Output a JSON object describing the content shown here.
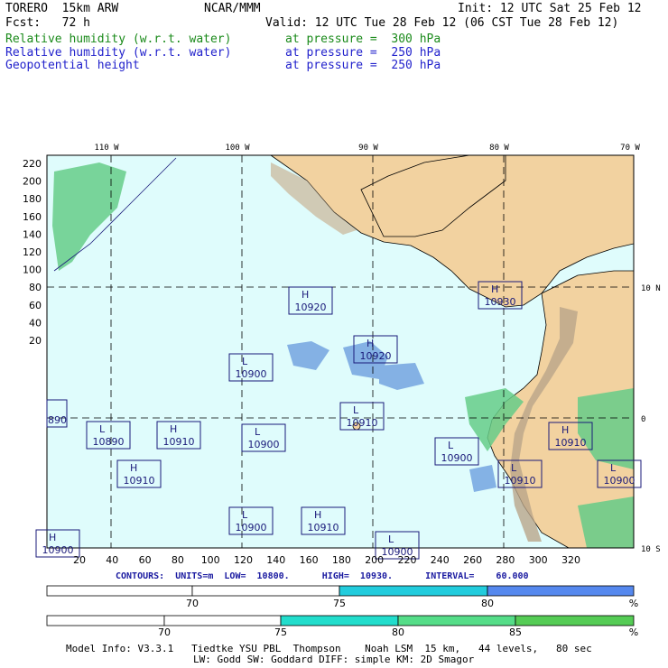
{
  "header": {
    "model": "TORERO  15km ARW",
    "org": "NCAR/MMM",
    "init": "Init: 12 UTC Sat 25 Feb 12",
    "fcst": "Fcst:   72 h",
    "valid": "Valid: 12 UTC Tue 28 Feb 12 (06 CST Tue 28 Feb 12)",
    "fields": [
      {
        "name": "Relative humidity (w.r.t. water)",
        "level": "at pressure =  300 hPa",
        "color": "#1a8a1a"
      },
      {
        "name": "Relative humidity (w.r.t. water)",
        "level": "at pressure =  250 hPa",
        "color": "#2222cc"
      },
      {
        "name": "Geopotential height",
        "level": "at pressure =  250 hPa",
        "color": "#2222cc"
      }
    ]
  },
  "map": {
    "lon_labels": [
      "110 W",
      "100 W",
      "90 W",
      "80 W",
      "70 W"
    ],
    "lat_labels": [
      "10 N",
      "0",
      "10 S"
    ],
    "y_ticks": [
      "220",
      "200",
      "180",
      "160",
      "140",
      "120",
      "100",
      "80",
      "60",
      "40",
      "20"
    ],
    "x_ticks": [
      "20",
      "40",
      "60",
      "80",
      "100",
      "120",
      "140",
      "160",
      "180",
      "200",
      "220",
      "240",
      "260",
      "280",
      "300",
      "320"
    ],
    "colors": {
      "ocean": "#dffcfc",
      "land": "#f2d2a0",
      "rh300": "#66cc88",
      "rh250": "#6699dd",
      "contour": "#1a1a7a"
    },
    "highs_lows": [
      {
        "type": "H",
        "value": "10920"
      },
      {
        "type": "H",
        "value": "10930"
      },
      {
        "type": "H",
        "value": "10920"
      },
      {
        "type": "L",
        "value": "10900"
      },
      {
        "type": "L",
        "value": "10910"
      },
      {
        "type": "L",
        "value": "10890"
      },
      {
        "type": "H",
        "value": "10910"
      },
      {
        "type": "L",
        "value": "10900"
      },
      {
        "type": "L",
        "value": "10900"
      },
      {
        "type": "H",
        "value": "10910"
      },
      {
        "type": "L",
        "value": "10910"
      },
      {
        "type": "H",
        "value": "10910"
      },
      {
        "type": "L",
        "value": "10900"
      },
      {
        "type": "H",
        "value": "10910"
      },
      {
        "type": "L",
        "value": "10900"
      },
      {
        "type": "H",
        "value": "10900"
      },
      {
        "type": "L",
        "value": "10900"
      }
    ],
    "edge_label": "890"
  },
  "contours_line": "CONTOURS:  UNITS=m  LOW=  10800.      HIGH=  10930.      INTERVAL=    60.000",
  "bars": [
    {
      "labels": [
        "70",
        "75",
        "80"
      ],
      "unit": "%",
      "colors": [
        "#ffffff",
        "#ffffff",
        "#22ccdd",
        "#5588ee"
      ]
    },
    {
      "labels": [
        "70",
        "75",
        "80",
        "85"
      ],
      "unit": "%",
      "colors": [
        "#ffffff",
        "#ffffff",
        "#22ddcc",
        "#55dd88",
        "#55cc55"
      ]
    }
  ],
  "footer": {
    "line1": "Model Info: V3.3.1   Tiedtke YSU PBL  Thompson    Noah LSM  15 km,   44 levels,   80 sec",
    "line2": "LW: Godd SW: Goddard DIFF: simple KM: 2D Smagor"
  }
}
